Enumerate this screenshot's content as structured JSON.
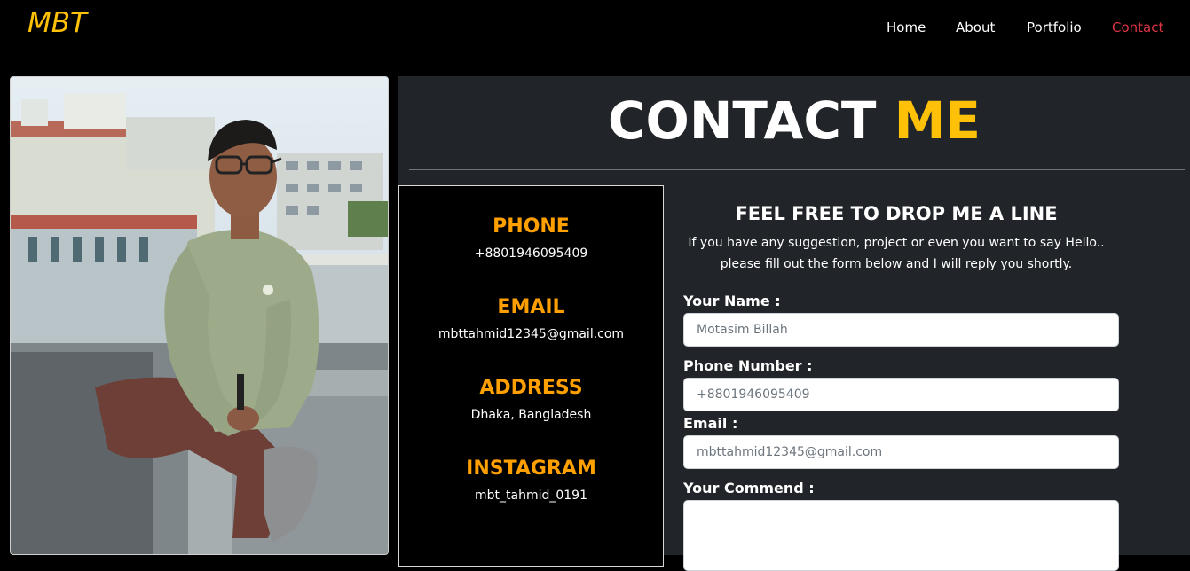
{
  "navbar": {
    "brand": "MBT",
    "links": [
      {
        "label": "Home",
        "active": false
      },
      {
        "label": "About",
        "active": false
      },
      {
        "label": "Portfolio",
        "active": false
      },
      {
        "label": "Contact",
        "active": true
      }
    ]
  },
  "contact": {
    "title_main": "CONTACT",
    "title_accent": "ME",
    "info": [
      {
        "label": "PHONE",
        "value": "+8801946095409"
      },
      {
        "label": "EMAIL",
        "value": "mbttahmid12345@gmail.com"
      },
      {
        "label": "ADDRESS",
        "value": "Dhaka, Bangladesh"
      },
      {
        "label": "INSTAGRAM",
        "value": "mbt_tahmid_0191"
      }
    ],
    "form": {
      "heading": "FEEL FREE TO DROP ME A LINE",
      "subtitle_line1": "If you have any suggestion, project or even you want to say Hello..",
      "subtitle_line2": "please fill out the form below and I will reply you shortly.",
      "name_label": "Your Name :",
      "name_placeholder": "Motasim Billah",
      "phone_label": "Phone Number :",
      "phone_placeholder": "+8801946095409",
      "email_label": "Email :",
      "email_placeholder": "mbttahmid12345@gmail.com",
      "comment_label": "Your Commend :"
    }
  },
  "colors": {
    "accent": "#ffc107",
    "info_label": "#ffa000",
    "active_link": "#dc3545",
    "panel_bg": "#212529"
  }
}
